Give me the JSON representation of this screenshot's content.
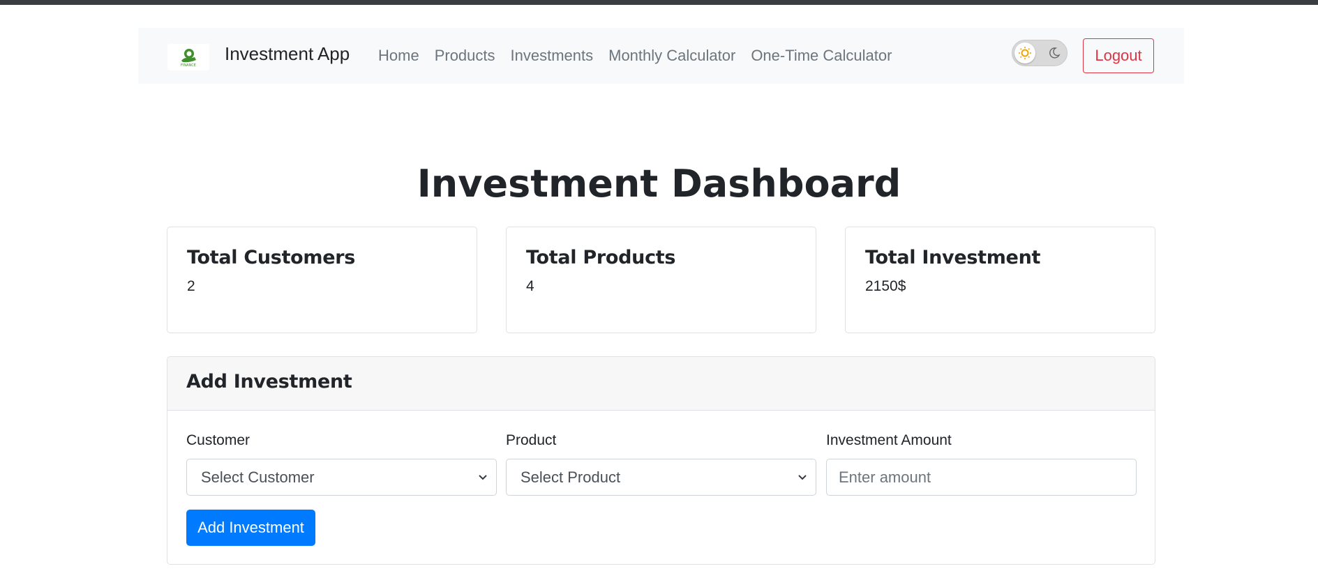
{
  "navbar": {
    "brand_name": "Investment App",
    "logo_text": "FINANCE",
    "links": [
      "Home",
      "Products",
      "Investments",
      "Monthly Calculator",
      "One-Time Calculator"
    ],
    "logout_label": "Logout",
    "theme_mode": "light"
  },
  "page": {
    "title": "Investment Dashboard"
  },
  "stats": [
    {
      "title": "Total Customers",
      "value": "2"
    },
    {
      "title": "Total Products",
      "value": "4"
    },
    {
      "title": "Total Investment",
      "value": "2150$"
    }
  ],
  "add_investment": {
    "header": "Add Investment",
    "customer_label": "Customer",
    "customer_selected": "Select Customer",
    "product_label": "Product",
    "product_selected": "Select Product",
    "amount_label": "Investment Amount",
    "amount_placeholder": "Enter amount",
    "submit_label": "Add Investment"
  },
  "colors": {
    "primary": "#007bff",
    "danger": "#dc3545",
    "navbar_bg": "#f8f9fa",
    "logo_green": "#3f8f2a"
  }
}
